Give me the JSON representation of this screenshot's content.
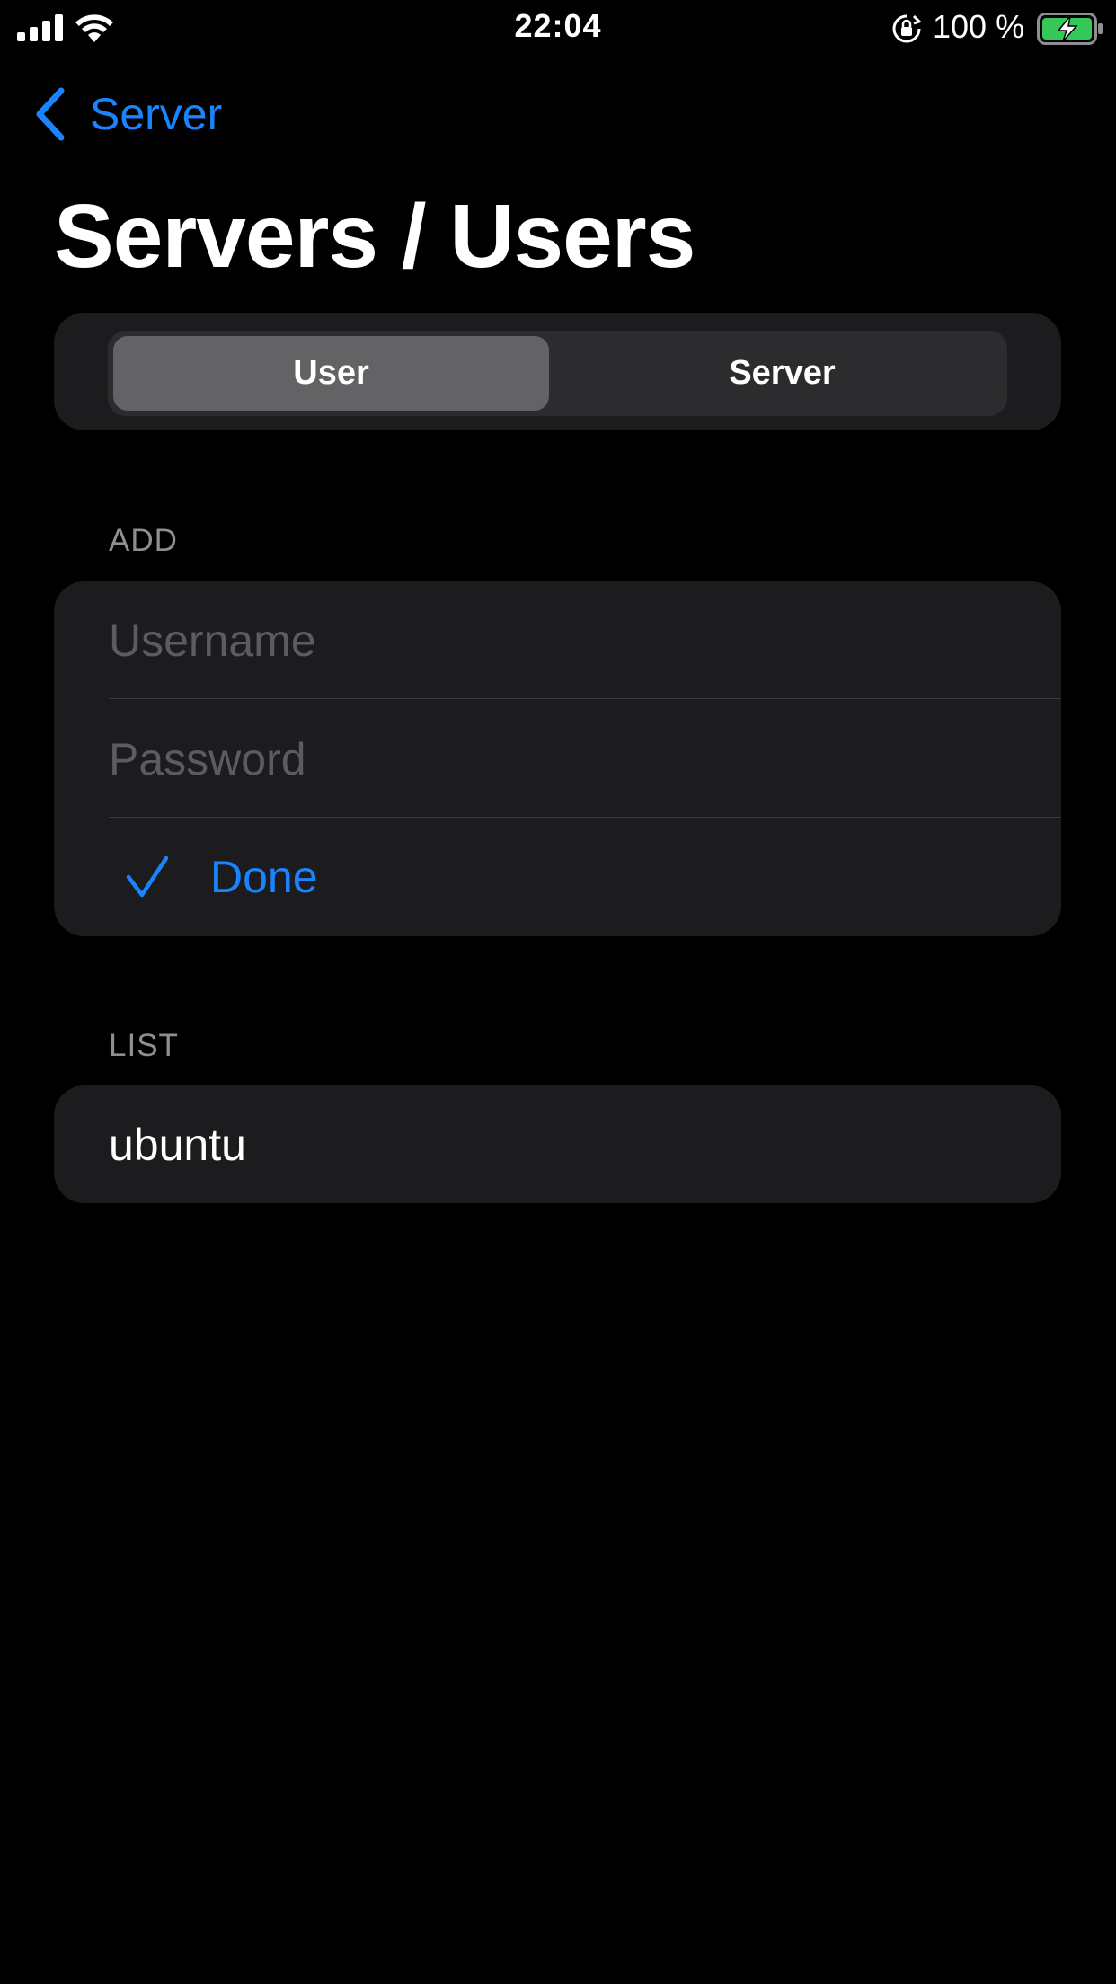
{
  "status_bar": {
    "time": "22:04",
    "battery_percent": "100 %",
    "battery_level": 1.0,
    "icons": [
      "signal-icon",
      "wifi-icon",
      "lock-rotation-icon",
      "battery-charging-icon"
    ]
  },
  "nav": {
    "back_label": "Server",
    "back_icon": "chevron-left-icon"
  },
  "page": {
    "title": "Servers / Users"
  },
  "segmented_control": {
    "segments": [
      {
        "label": "User",
        "selected": true
      },
      {
        "label": "Server",
        "selected": false
      }
    ]
  },
  "add_section": {
    "header": "ADD",
    "username": {
      "value": "",
      "placeholder": "Username"
    },
    "password": {
      "value": "",
      "placeholder": "Password"
    },
    "done_label": "Done",
    "done_icon": "checkmark-icon"
  },
  "list_section": {
    "header": "LIST",
    "items": [
      {
        "label": "ubuntu"
      }
    ]
  },
  "colors": {
    "background": "#000000",
    "card": "#1c1c1e",
    "accent": "#1a84ff",
    "segment_selected": "#636366",
    "battery_fill": "#34c759"
  }
}
